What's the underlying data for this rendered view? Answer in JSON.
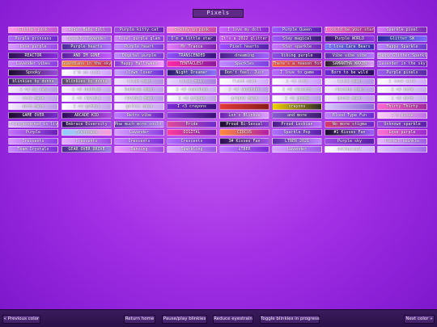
{
  "header": {
    "title": "Pixels"
  },
  "buttons": {
    "prev": "« Previous color",
    "return_home": "Return home",
    "pause_play": "Pause/play blinkies",
    "reduce_eyestrain": "Reduce eyestrain",
    "toggle_progress": "Toggle blinkies in progress",
    "next": "Next color »"
  },
  "blinkies": [
    {
      "text": "Glitter pink",
      "c1": "#ff9ae6",
      "c2": "#c95bd6"
    },
    {
      "text": "Angel Baby doll",
      "c1": "#e59cf6",
      "c2": "#b05ce0"
    },
    {
      "text": "Purple kitty cat",
      "c1": "#a14fe0",
      "c2": "#6d22b8"
    },
    {
      "text": "Pretty in pink",
      "c1": "#ff8fd8",
      "c2": "#cc4aa6"
    },
    {
      "text": "I love my doll",
      "c1": "#cc66ff",
      "c2": "#8a2ad0"
    },
    {
      "text": "Purple Queen",
      "c1": "#9d5cff",
      "c2": "#5a1fb0"
    },
    {
      "text": "I could be your starry",
      "c1": "#ff6fd0",
      "c2": "#a02a9a"
    },
    {
      "text": "Sparkle pixel",
      "c1": "#d77aff",
      "c2": "#7b2ab5"
    },
    {
      "text": "Purple princess",
      "c1": "#b06cff",
      "c2": "#6f2ad0"
    },
    {
      "text": "Sparkly lavender",
      "c1": "#e3b4ff",
      "c2": "#a366e6"
    },
    {
      "text": "Pixel purple glam",
      "c1": "#cf86ff",
      "c2": "#8c3ee0"
    },
    {
      "text": "I'm a little star",
      "c1": "#8d4fe0",
      "c2": "#4f1f93"
    },
    {
      "text": "It's a 2022 glitter",
      "c1": "#d25bff",
      "c2": "#7d1fb8"
    },
    {
      "text": "Stay magical",
      "c1": "#a05cff",
      "c2": "#3c1a78"
    },
    {
      "text": "Purple WORLD",
      "c1": "#3a1a6e",
      "c2": "#8b35e0"
    },
    {
      "text": "Glitter SW",
      "c1": "#2a2a9a",
      "c2": "#7c6cff"
    },
    {
      "text": "Love purple",
      "c1": "#d898ff",
      "c2": "#9a4de6"
    },
    {
      "text": "Purple hearts",
      "c1": "#4a2a9a",
      "c2": "#b077ff"
    },
    {
      "text": "Purple heart",
      "c1": "#c58fff",
      "c2": "#803ed8"
    },
    {
      "text": "Mr Trance",
      "c1": "#e37dff",
      "c2": "#7b1fb0"
    },
    {
      "text": "Pixel hearts",
      "c1": "#9b4dff",
      "c2": "#5523aa"
    },
    {
      "text": "Star sparkle",
      "c1": "#c87cff",
      "c2": "#6f2ab8"
    },
    {
      "text": "I love Care Bears",
      "c1": "#7a7aff",
      "c2": "#3a2ab0"
    },
    {
      "text": "Happy Sparkle",
      "c1": "#b986ff",
      "c2": "#6a3bd0"
    },
    {
      "text": "REACTOR",
      "c1": "#2a1050",
      "c2": "#8a2ae0"
    },
    {
      "text": "AND IM GONE",
      "c1": "#5a1fa0",
      "c2": "#c45cff"
    },
    {
      "text": "Digital purple",
      "c1": "#c48aff",
      "c2": "#7d39d6"
    },
    {
      "text": "TRANSCENDED",
      "c1": "#9050ff",
      "c2": "#3a1080"
    },
    {
      "text": "dreaming",
      "c1": "#4a1f8a",
      "c2": "#a062ff"
    },
    {
      "text": "Vibing purple",
      "c1": "#8d4fe6",
      "c2": "#3b147a"
    },
    {
      "text": "Vibe vibe vibe",
      "c1": "#5c2aa8",
      "c2": "#b57cff"
    },
    {
      "text": "Happy Glitter Sparkle",
      "c1": "#d9a0ff",
      "c2": "#9451e6"
    },
    {
      "text": "Lavender vibes",
      "c1": "#c989ff",
      "c2": "#8a3ee0"
    },
    {
      "text": "Guardians in the sky",
      "c1": "#ff8a3a",
      "c2": "#c42a6a"
    },
    {
      "text": "Happy Halloween",
      "c1": "#8a3ad6",
      "c2": "#f7a0ff"
    },
    {
      "text": "TENTACLES!",
      "c1": "#ff2aa6",
      "c2": "#8a1a9e"
    },
    {
      "text": "Sparkles",
      "c1": "#c08aff",
      "c2": "#7c3fe0"
    },
    {
      "text": "There's a reason for this",
      "c1": "#ff5a3a",
      "c2": "#a02a80"
    },
    {
      "text": "SAMANTHA WAXIN",
      "c1": "#2a1a2a",
      "c2": "#e0a0ff"
    },
    {
      "text": "Lavender in the sky",
      "c1": "#b870ff",
      "c2": "#6b1fc0"
    },
    {
      "text": "Spooky",
      "c1": "#1a0a2a",
      "c2": "#9a4ae0"
    },
    {
      "text": "I'm so cute",
      "c1": "#ffffff",
      "c2": "#cfa0ff"
    },
    {
      "text": "clown lover",
      "c1": "#c8a4ff",
      "c2": "#6e30d6"
    },
    {
      "text": "Night Dreamer",
      "c1": "#2a1a6a",
      "c2": "#9070ff"
    },
    {
      "text": "Don't feel. Just",
      "c1": "#4a2a8a",
      "c2": "#c080ff"
    },
    {
      "text": "I love to game",
      "c1": "#b86cff",
      "c2": "#6d23c9"
    },
    {
      "text": "Born to be wild",
      "c1": "#6c2ad6",
      "c2": "#2a0a5a"
    },
    {
      "text": "Purple pixels",
      "c1": "#9a5cf0",
      "c2": "#5a2aa8"
    },
    {
      "text": "blinkies by donna",
      "c1": "#3a2a5a",
      "c2": "#a07ad6"
    },
    {
      "text": "blinkies by donna",
      "c1": "#5a4a6a",
      "c2": "#c8a0e6"
    },
    {
      "text": "lilac main",
      "c1": "#f0e0ff",
      "c2": "#b090e0"
    },
    {
      "text": "lilac main",
      "c1": "#e8d8ff",
      "c2": "#a880e0"
    },
    {
      "text": "flash main",
      "c1": "#ffffff",
      "c2": "#d0a8ff"
    },
    {
      "text": "I <3 cute",
      "c1": "#ffffff",
      "c2": "#c898ff"
    },
    {
      "text": "lilac main",
      "c1": "#f2e6ff",
      "c2": "#b090e6"
    },
    {
      "text": "I love cute",
      "c1": "#ffffff",
      "c2": "#d0a8ff"
    },
    {
      "text": "I <3 my cat",
      "c1": "#f6eaff",
      "c2": "#b898e6"
    },
    {
      "text": "I <3 bubbles",
      "c1": "#fcf2ff",
      "c2": "#c8a8ee"
    },
    {
      "text": "bubbles main",
      "c1": "#f6ecff",
      "c2": "#c0a0ea"
    },
    {
      "text": "I <3 cupcakes",
      "c1": "#ffffff",
      "c2": "#c8a8ee"
    },
    {
      "text": "I <3 lavender",
      "c1": "#f8eeff",
      "c2": "#b898e6"
    },
    {
      "text": "I <3 raisins",
      "c1": "#ffffff",
      "c2": "#c0a0ea"
    },
    {
      "text": "raisins main",
      "c1": "#f6eaff",
      "c2": "#b898e6"
    },
    {
      "text": "I <3 sora",
      "c1": "#ffffff",
      "c2": "#c8a8ee"
    },
    {
      "text": "sora main",
      "c1": "#f6eaff",
      "c2": "#c0a0ea"
    },
    {
      "text": "I <3 ravioli",
      "c1": "#ffffff",
      "c2": "#c8a8ee"
    },
    {
      "text": "ravioli main",
      "c1": "#f6ecff",
      "c2": "#b898e6"
    },
    {
      "text": "I <3 grapes",
      "c1": "#ffffff",
      "c2": "#c0a0ea"
    },
    {
      "text": "grapes main",
      "c1": "#f8eeff",
      "c2": "#c8a8ee"
    },
    {
      "text": "I <3 gnome",
      "c1": "#ffffff",
      "c2": "#b898e6"
    },
    {
      "text": "gnome main",
      "c1": "#f6eaff",
      "c2": "#c0a0ea"
    },
    {
      "text": "I <3 dorm",
      "c1": "#ffffff",
      "c2": "#c8a8ee"
    },
    {
      "text": "dorm main",
      "c1": "#f6ecff",
      "c2": "#b898e6"
    },
    {
      "text": "I <3 gothic",
      "c1": "#ffffff",
      "c2": "#c0a0ea"
    },
    {
      "text": "gothic main",
      "c1": "#f8eeff",
      "c2": "#c8a8ee"
    },
    {
      "text": "I <3 crayons",
      "c1": "#7c2ad6",
      "c2": "#3a0f7a"
    },
    {
      "text": "",
      "c1": "#e43a3a",
      "c2": "#8a1a1a"
    },
    {
      "text": "crayons",
      "c1": "#f3d200",
      "c2": "#2a2a2a"
    },
    {
      "text": "",
      "c1": "#d8c8ff",
      "c2": "#8a6ad0"
    },
    {
      "text": "Thirty Thirty",
      "c1": "#ff6ad0",
      "c2": "#a02a9a"
    },
    {
      "text": "GAME OVER",
      "c1": "#1a0a2a",
      "c2": "#7a2ad0"
    },
    {
      "text": "ARCADE KID",
      "c1": "#2a0a5a",
      "c2": "#b04ae6"
    },
    {
      "text": "Retro vibe",
      "c1": "#c07cff",
      "c2": "#6b22c0"
    },
    {
      "text": "",
      "c1": "#8a3ad6",
      "c2": "#3a0f7a"
    },
    {
      "text": "Lon's Blinkie",
      "c1": "#6a1fb0",
      "c2": "#e0a0ff"
    },
    {
      "text": "and more",
      "c1": "#8a5ad6",
      "c2": "#3a1a6e"
    },
    {
      "text": "Blood Type Fun",
      "c1": "#c080ff",
      "c2": "#6a2ad0"
    },
    {
      "text": "I'm pixie",
      "c1": "#ffd0f6",
      "c2": "#c070e6"
    },
    {
      "text": "Transgendered is living it",
      "c1": "#e6c0ff",
      "c2": "#9a58e6"
    },
    {
      "text": "Embrace Diversity",
      "c1": "#2a1050",
      "c2": "#a050e6"
    },
    {
      "text": "How much more could HE be?",
      "c1": "#5a2aa8",
      "c2": "#c08aff"
    },
    {
      "text": "Pride",
      "c1": "#e04a9a",
      "c2": "#6a2ad0"
    },
    {
      "text": "Proud Bi-Sexual",
      "c1": "#1a0a2a",
      "c2": "#8a3ad6"
    },
    {
      "text": "Proud Lesbian",
      "c1": "#4a1a8a",
      "c2": "#c070ff"
    },
    {
      "text": "No more stigma",
      "c1": "#d63a6a",
      "c2": "#6a2ad0"
    },
    {
      "text": "Unknown sparkle",
      "c1": "#9a4ae0",
      "c2": "#5a1fa8"
    },
    {
      "text": "Purple",
      "c1": "#c470ff",
      "c2": "#6a1fb8"
    },
    {
      "text": "Transmasc",
      "c1": "#8ad0ff",
      "c2": "#ff9ad8"
    },
    {
      "text": "Lavender",
      "c1": "#d8a0ff",
      "c2": "#8a3ee0"
    },
    {
      "text": "DIGITAL",
      "c1": "#ff3a9a",
      "c2": "#7a1fb8"
    },
    {
      "text": "CIRCUS",
      "c1": "#ff8a3a",
      "c2": "#b01fa8"
    },
    {
      "text": "Sparkle Pop",
      "c1": "#b070ff",
      "c2": "#5a1fa8"
    },
    {
      "text": "#1 Kisses Fan",
      "c1": "#1a0a2a",
      "c2": "#a060ff"
    },
    {
      "text": "Love purple",
      "c1": "#ff70d0",
      "c2": "#9a2ad0"
    },
    {
      "text": "Crescents",
      "c1": "#d89cff",
      "c2": "#8c3ee6"
    },
    {
      "text": "Crescents",
      "c1": "#e6b0ff",
      "c2": "#9a4ae6"
    },
    {
      "text": "Crescents",
      "c1": "#c480ff",
      "c2": "#7c30d6"
    },
    {
      "text": "Crescents",
      "c1": "#b070ff",
      "c2": "#6a22c8"
    },
    {
      "text": "3# Kisses Fan",
      "c1": "#2a1050",
      "c2": "#a050e6"
    },
    {
      "text": "LTBER 2021",
      "c1": "#5a2aa8",
      "c2": "#c08aff"
    },
    {
      "text": "Purple sky",
      "c1": "#9a4ae0",
      "c2": "#5a1fa8"
    },
    {
      "text": "Pastel twinkle",
      "c1": "#e6b8ff",
      "c2": "#a060e6"
    },
    {
      "text": "Team Crystals",
      "c1": "#c88cff",
      "c2": "#7c30d6"
    },
    {
      "text": "GEAR OVER DRIVE",
      "c1": "#4a2a8a",
      "c2": "#a080e6"
    },
    {
      "text": "Dancing",
      "c1": "#f0a0ff",
      "c2": "#a04ae0"
    },
    {
      "text": "Sparkling",
      "c1": "#e0b0ff",
      "c2": "#9a58e6"
    },
    {
      "text": "LTBER",
      "c1": "#c080ff",
      "c2": "#7a2ad6"
    },
    {
      "text": "Lavender",
      "c1": "#d8a8ff",
      "c2": "#9a5ce6"
    },
    {
      "text": "enthusiast",
      "c1": "#ffffff",
      "c2": "#d0b0ff"
    },
    {
      "text": "",
      "c1": "#e4c8ff",
      "c2": "#a070e6"
    }
  ]
}
